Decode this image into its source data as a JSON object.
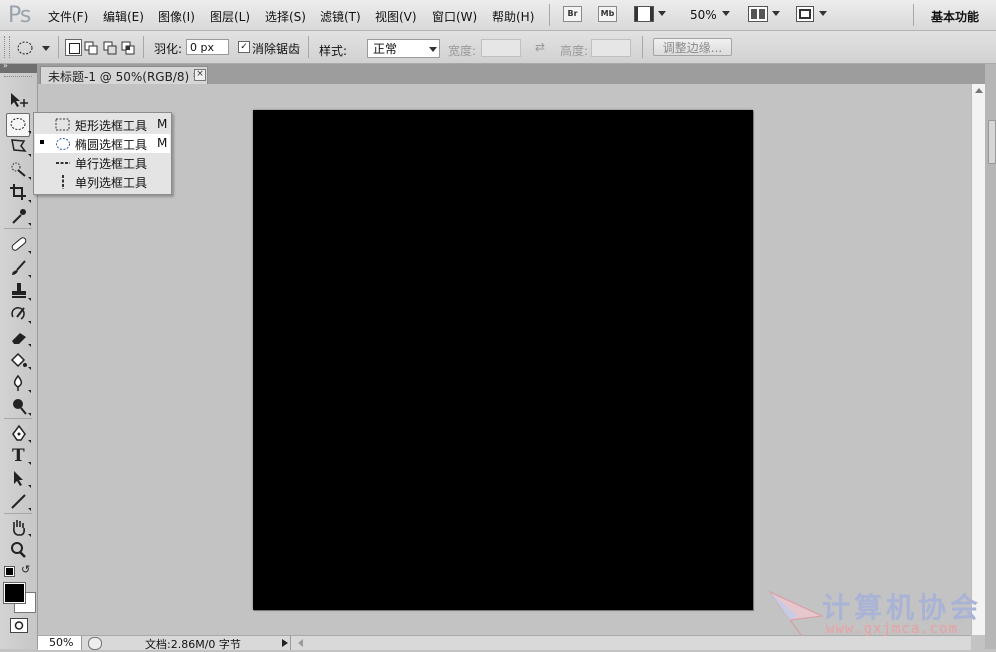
{
  "app": {
    "logo": "Ps",
    "workspace": "基本功能"
  },
  "menu": [
    "文件(F)",
    "编辑(E)",
    "图像(I)",
    "图层(L)",
    "选择(S)",
    "滤镜(T)",
    "视图(V)",
    "窗口(W)",
    "帮助(H)"
  ],
  "appbar": {
    "bridge": "Br",
    "mini_bridge": "Mb",
    "zoom": "50%"
  },
  "options": {
    "feather_label": "羽化:",
    "feather_value": "0 px",
    "antialias_label": "消除锯齿",
    "antialias_checked": true,
    "style_label": "样式:",
    "style_value": "正常",
    "width_label": "宽度:",
    "height_label": "高度:",
    "refine_edge": "调整边缘..."
  },
  "document": {
    "tab_title": "未标题-1 @ 50%(RGB/8) *",
    "close_glyph": "×"
  },
  "flyout": [
    {
      "label": "矩形选框工具",
      "key": "M",
      "selected": false,
      "icon": "rect-marquee-icon"
    },
    {
      "label": "椭圆选框工具",
      "key": "M",
      "selected": true,
      "icon": "ellipse-marquee-icon"
    },
    {
      "label": "单行选框工具",
      "key": "",
      "selected": false,
      "icon": "single-row-marquee-icon"
    },
    {
      "label": "单列选框工具",
      "key": "",
      "selected": false,
      "icon": "single-column-marquee-icon"
    }
  ],
  "colors": {
    "foreground": "#000000",
    "background": "#ffffff",
    "canvas": "#000000"
  },
  "status": {
    "zoom": "50%",
    "doc_info": "文档:2.86M/0 字节"
  },
  "watermark": {
    "title": "计算机协会",
    "url": "www.gxjmca.com"
  }
}
